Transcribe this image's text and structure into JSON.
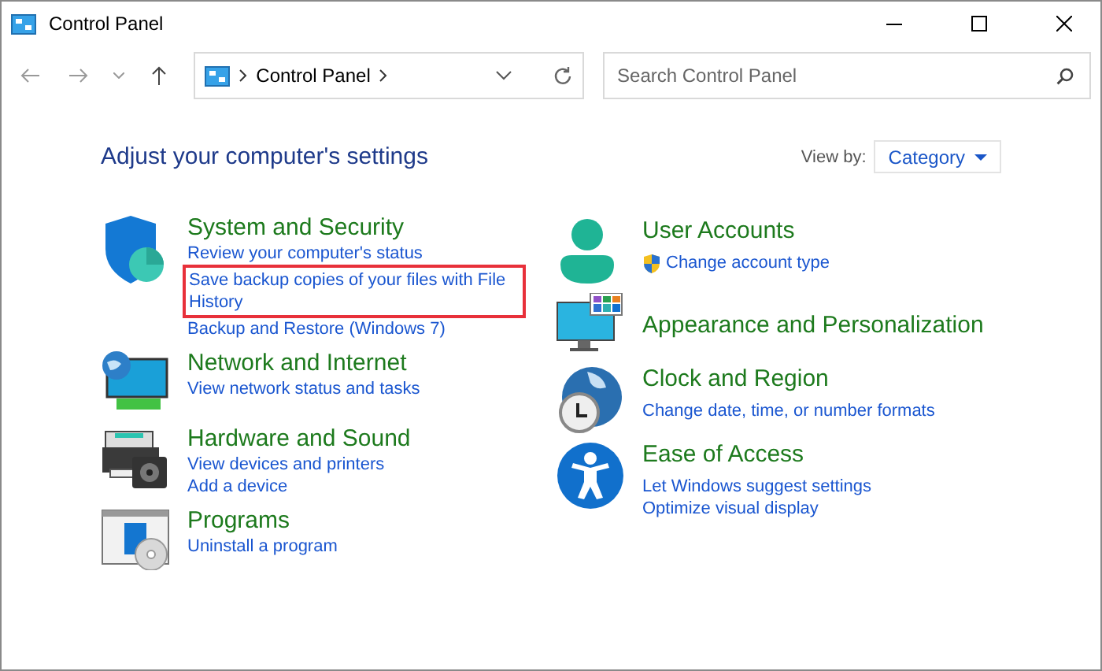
{
  "window": {
    "title": "Control Panel"
  },
  "address_bar": {
    "path": "Control Panel"
  },
  "search": {
    "placeholder": "Search Control Panel"
  },
  "heading": "Adjust your computer's settings",
  "view_by": {
    "label": "View by:",
    "value": "Category"
  },
  "columns": [
    {
      "categories": [
        {
          "kind": "security",
          "title": "System and Security",
          "links": [
            {
              "text": "Review your computer's status",
              "highlighted": false,
              "shield": false
            },
            {
              "text": "Save backup copies of your files with File History",
              "highlighted": true,
              "shield": false
            },
            {
              "text": "Backup and Restore (Windows 7)",
              "highlighted": false,
              "shield": false
            }
          ]
        },
        {
          "kind": "network",
          "title": "Network and Internet",
          "links": [
            {
              "text": "View network status and tasks",
              "highlighted": false,
              "shield": false
            }
          ]
        },
        {
          "kind": "hardware",
          "title": "Hardware and Sound",
          "links": [
            {
              "text": "View devices and printers",
              "highlighted": false,
              "shield": false
            },
            {
              "text": "Add a device",
              "highlighted": false,
              "shield": false
            }
          ]
        },
        {
          "kind": "programs",
          "title": "Programs",
          "links": [
            {
              "text": "Uninstall a program",
              "highlighted": false,
              "shield": false
            }
          ]
        }
      ]
    },
    {
      "categories": [
        {
          "kind": "users",
          "title": "User Accounts",
          "links": [
            {
              "text": "Change account type",
              "highlighted": false,
              "shield": true
            }
          ]
        },
        {
          "kind": "appearance",
          "title": "Appearance and Personalization"
        },
        {
          "kind": "clock",
          "title": "Clock and Region",
          "links": [
            {
              "text": "Change date, time, or number formats",
              "highlighted": false,
              "shield": false
            }
          ]
        },
        {
          "kind": "access",
          "title": "Ease of Access",
          "links": [
            {
              "text": "Let Windows suggest settings",
              "highlighted": false,
              "shield": false
            },
            {
              "text": "Optimize visual display",
              "highlighted": false,
              "shield": false
            }
          ]
        }
      ]
    }
  ]
}
